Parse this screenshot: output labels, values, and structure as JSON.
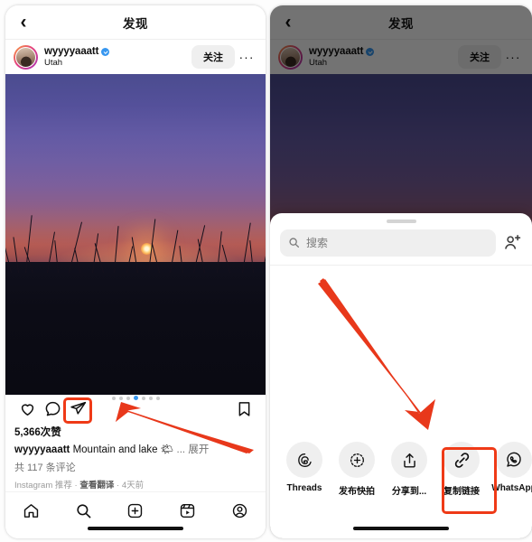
{
  "left_phone": {
    "nav": {
      "back_icon": "chevron-left-icon",
      "title": "发现"
    },
    "post": {
      "username": "wyyyyaaatt",
      "verified": true,
      "location": "Utah",
      "follow_label": "关注",
      "more_label": "···",
      "likes": "5,366次赞",
      "caption_user": "wyyyyaaatt",
      "caption_text": " Mountain and lake 🌤 ",
      "caption_more": "... 展开",
      "comments": "共 117 条评论",
      "sub_source": "Instagram 推荐",
      "sub_translate": "查看翻译",
      "sub_time": "4天前",
      "carousel_dots": 7,
      "carousel_active_index": 3
    },
    "actions": [
      {
        "name": "like-button",
        "icon": "heart-icon"
      },
      {
        "name": "comment-button",
        "icon": "comment-bubble-icon"
      },
      {
        "name": "share-button",
        "icon": "paper-plane-icon",
        "highlighted": true
      },
      {
        "name": "save-button",
        "icon": "bookmark-icon"
      }
    ],
    "tabbar": [
      {
        "name": "tab-home",
        "icon": "home-icon"
      },
      {
        "name": "tab-search",
        "icon": "search-icon"
      },
      {
        "name": "tab-create",
        "icon": "plus-square-icon"
      },
      {
        "name": "tab-reels",
        "icon": "reels-icon"
      },
      {
        "name": "tab-profile",
        "icon": "profile-circle-icon"
      }
    ]
  },
  "right_phone": {
    "nav": {
      "back_icon": "chevron-left-icon",
      "title": "发现"
    },
    "post": {
      "username": "wyyyyaaatt",
      "location": "Utah",
      "follow_label": "关注",
      "more_label": "···"
    },
    "share_sheet": {
      "grabber": "sheet-grab-handle",
      "search_placeholder": "搜索",
      "search_icon": "search-icon",
      "add_people_icon": "add-person-icon",
      "targets": [
        {
          "name": "share-threads",
          "label": "Threads",
          "icon": "threads-icon",
          "highlighted": false
        },
        {
          "name": "share-story",
          "label": "发布快拍",
          "icon": "add-to-story-icon",
          "highlighted": false
        },
        {
          "name": "share-to",
          "label": "分享到...",
          "icon": "share-up-icon",
          "highlighted": false
        },
        {
          "name": "share-copy-link",
          "label": "复制链接",
          "icon": "link-chain-icon",
          "highlighted": true
        },
        {
          "name": "share-whatsapp",
          "label": "WhatsApp",
          "icon": "whatsapp-icon",
          "highlighted": false
        }
      ]
    }
  },
  "annotations": {
    "highlight_color": "#ef3a17",
    "arrow_color": "#e8381b",
    "left_arrow_target": "share-button",
    "right_arrow_target": "share-copy-link"
  }
}
